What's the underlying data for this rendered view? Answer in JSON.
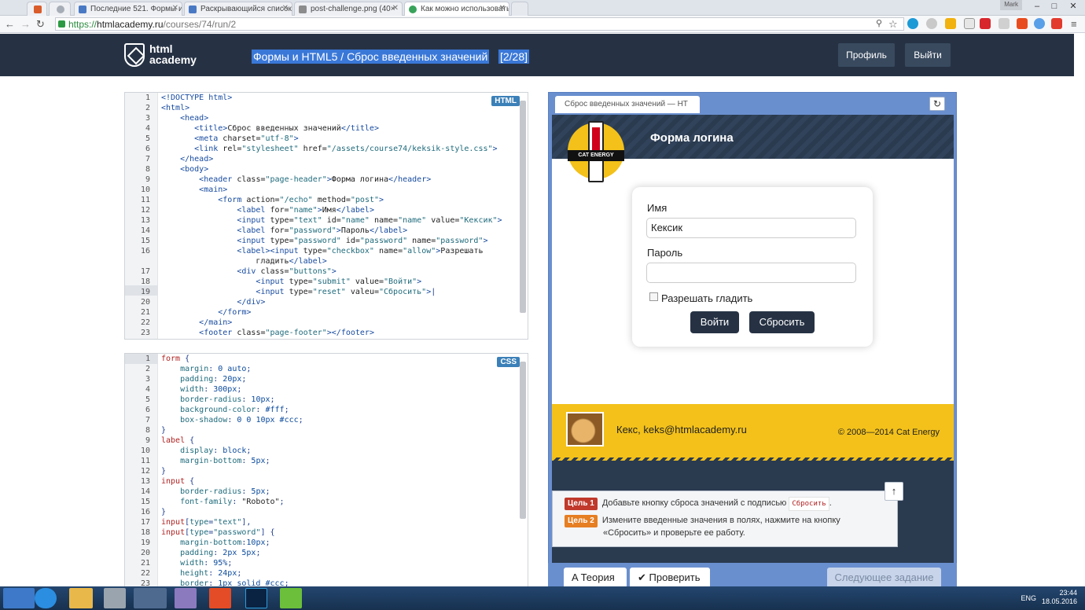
{
  "browser": {
    "tabs": [
      {
        "label": "Последние 521. Формы и"
      },
      {
        "label": "Раскрывающийся список"
      },
      {
        "label": "post-challenge.png (40×"
      },
      {
        "label": "Как можно использовать"
      }
    ],
    "user": "Mark",
    "url_scheme": "https://",
    "url_host": "htmlacademy.ru",
    "url_path": "/courses/74/run/2"
  },
  "header": {
    "logo_line1": "html",
    "logo_line2": "academy",
    "course_title": "Формы и HTML5 / Сброс введенных значений",
    "progress": "[2/28]",
    "profile_label": "Профиль",
    "logout_label": "Выйти"
  },
  "html_editor": {
    "badge": "HTML",
    "line_numbers": [
      "1",
      "2",
      "3",
      "4",
      "5",
      "6",
      "7",
      "8",
      "9",
      "10",
      "11",
      "12",
      "13",
      "14",
      "15",
      "16",
      "",
      "17",
      "18",
      "19",
      "20",
      "21",
      "22",
      "23"
    ]
  },
  "css_editor": {
    "badge": "CSS",
    "line_numbers": [
      "1",
      "2",
      "3",
      "4",
      "5",
      "6",
      "7",
      "8",
      "9",
      "10",
      "11",
      "12",
      "13",
      "14",
      "15",
      "16",
      "17",
      "18",
      "19",
      "20",
      "21",
      "22",
      "23"
    ]
  },
  "preview": {
    "tab_label": "Сброс введенных значений — HT",
    "site_title": "Форма логина",
    "logo_text": "CAT ENERGY",
    "form": {
      "name_label": "Имя",
      "name_value": "Кексик",
      "password_label": "Пароль",
      "password_value": "",
      "checkbox_label": "Разрешать гладить",
      "submit_label": "Войти",
      "reset_label": "Сбросить"
    },
    "footer_contact": "Кекс, keks@htmlacademy.ru",
    "footer_copyright": "© 2008—2014 Cat Energy",
    "goals": [
      {
        "badge": "Цель 1",
        "color": "#c0392b",
        "text": "Добавьте кнопку сброса значений с подписью",
        "code": "Сбросить",
        "tail": "."
      },
      {
        "badge": "Цель 2",
        "color": "#e67e22",
        "text": "Измените введенные значения в полях, нажмите на кнопку",
        "text2": "«Сбросить» и проверьте ее работу."
      }
    ],
    "theory_label": "Теория",
    "check_label": "Проверить",
    "next_label": "Следующее задание"
  },
  "taskbar": {
    "lang": "ENG",
    "time": "23:44",
    "date": "18.05.2016"
  },
  "colors": {
    "header_bg": "#263244",
    "preview_frame": "#6a8fcf",
    "accent_yellow": "#f3c11a"
  }
}
